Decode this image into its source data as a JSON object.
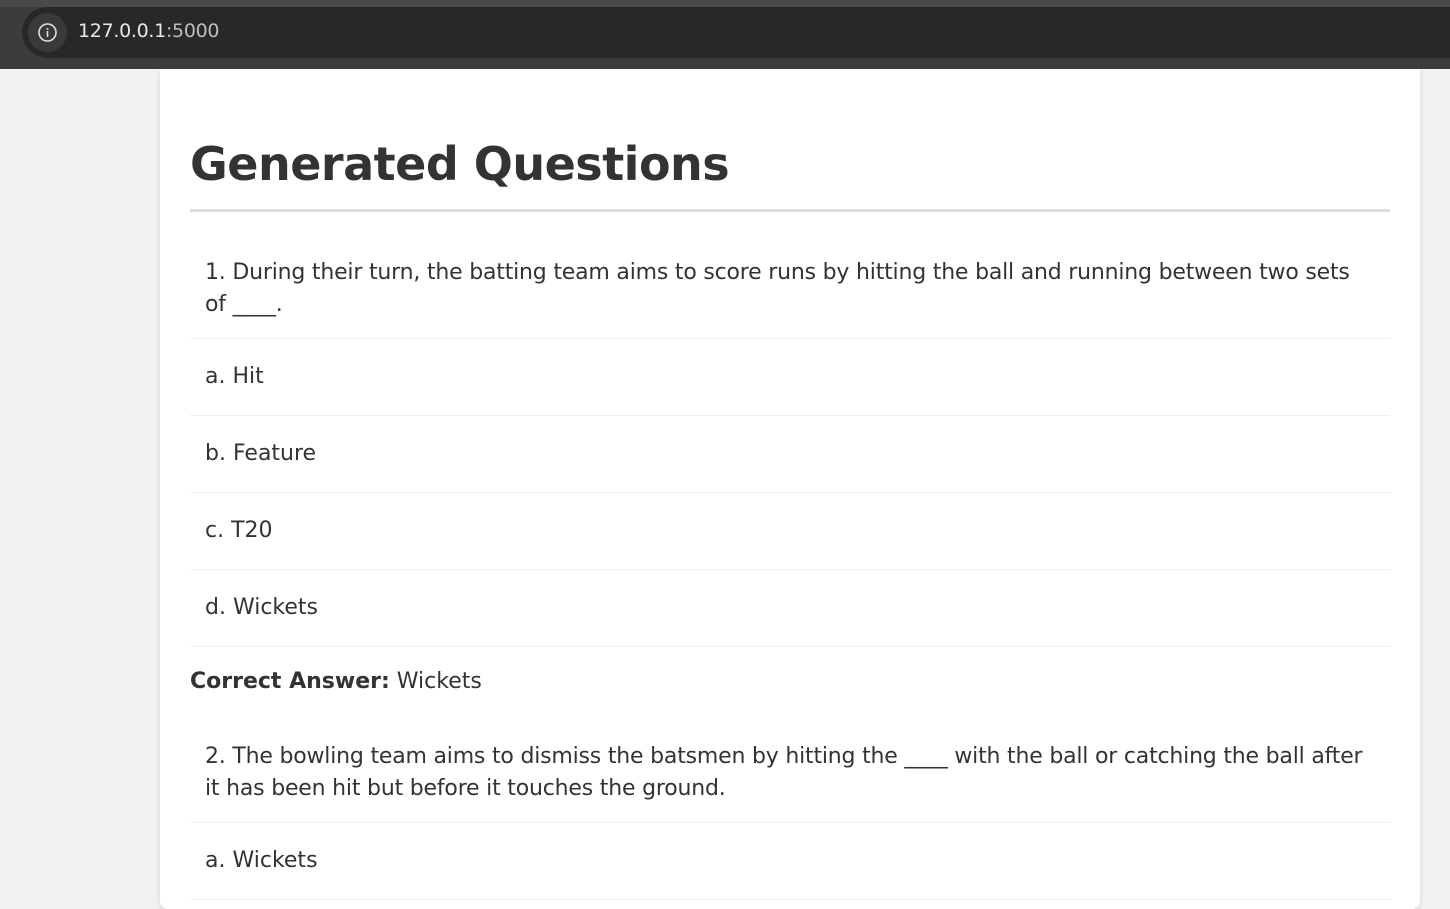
{
  "browser": {
    "url_host": "127.0.0.1",
    "url_port": ":5000",
    "info_icon": "info-icon"
  },
  "page": {
    "title": "Generated Questions",
    "correct_answer_label": "Correct Answer:"
  },
  "questions": [
    {
      "text": "1. During their turn, the batting team aims to score runs by hitting the ball and running between two sets of ____.",
      "options": [
        "a. Hit",
        "b. Feature",
        "c. T20",
        "d. Wickets"
      ],
      "correct": " Wickets"
    },
    {
      "text": "2. The bowling team aims to dismiss the batsmen by hitting the ____ with the ball or catching the ball after it has been hit but before it touches the ground.",
      "options": [
        "a. Wickets"
      ]
    }
  ]
}
